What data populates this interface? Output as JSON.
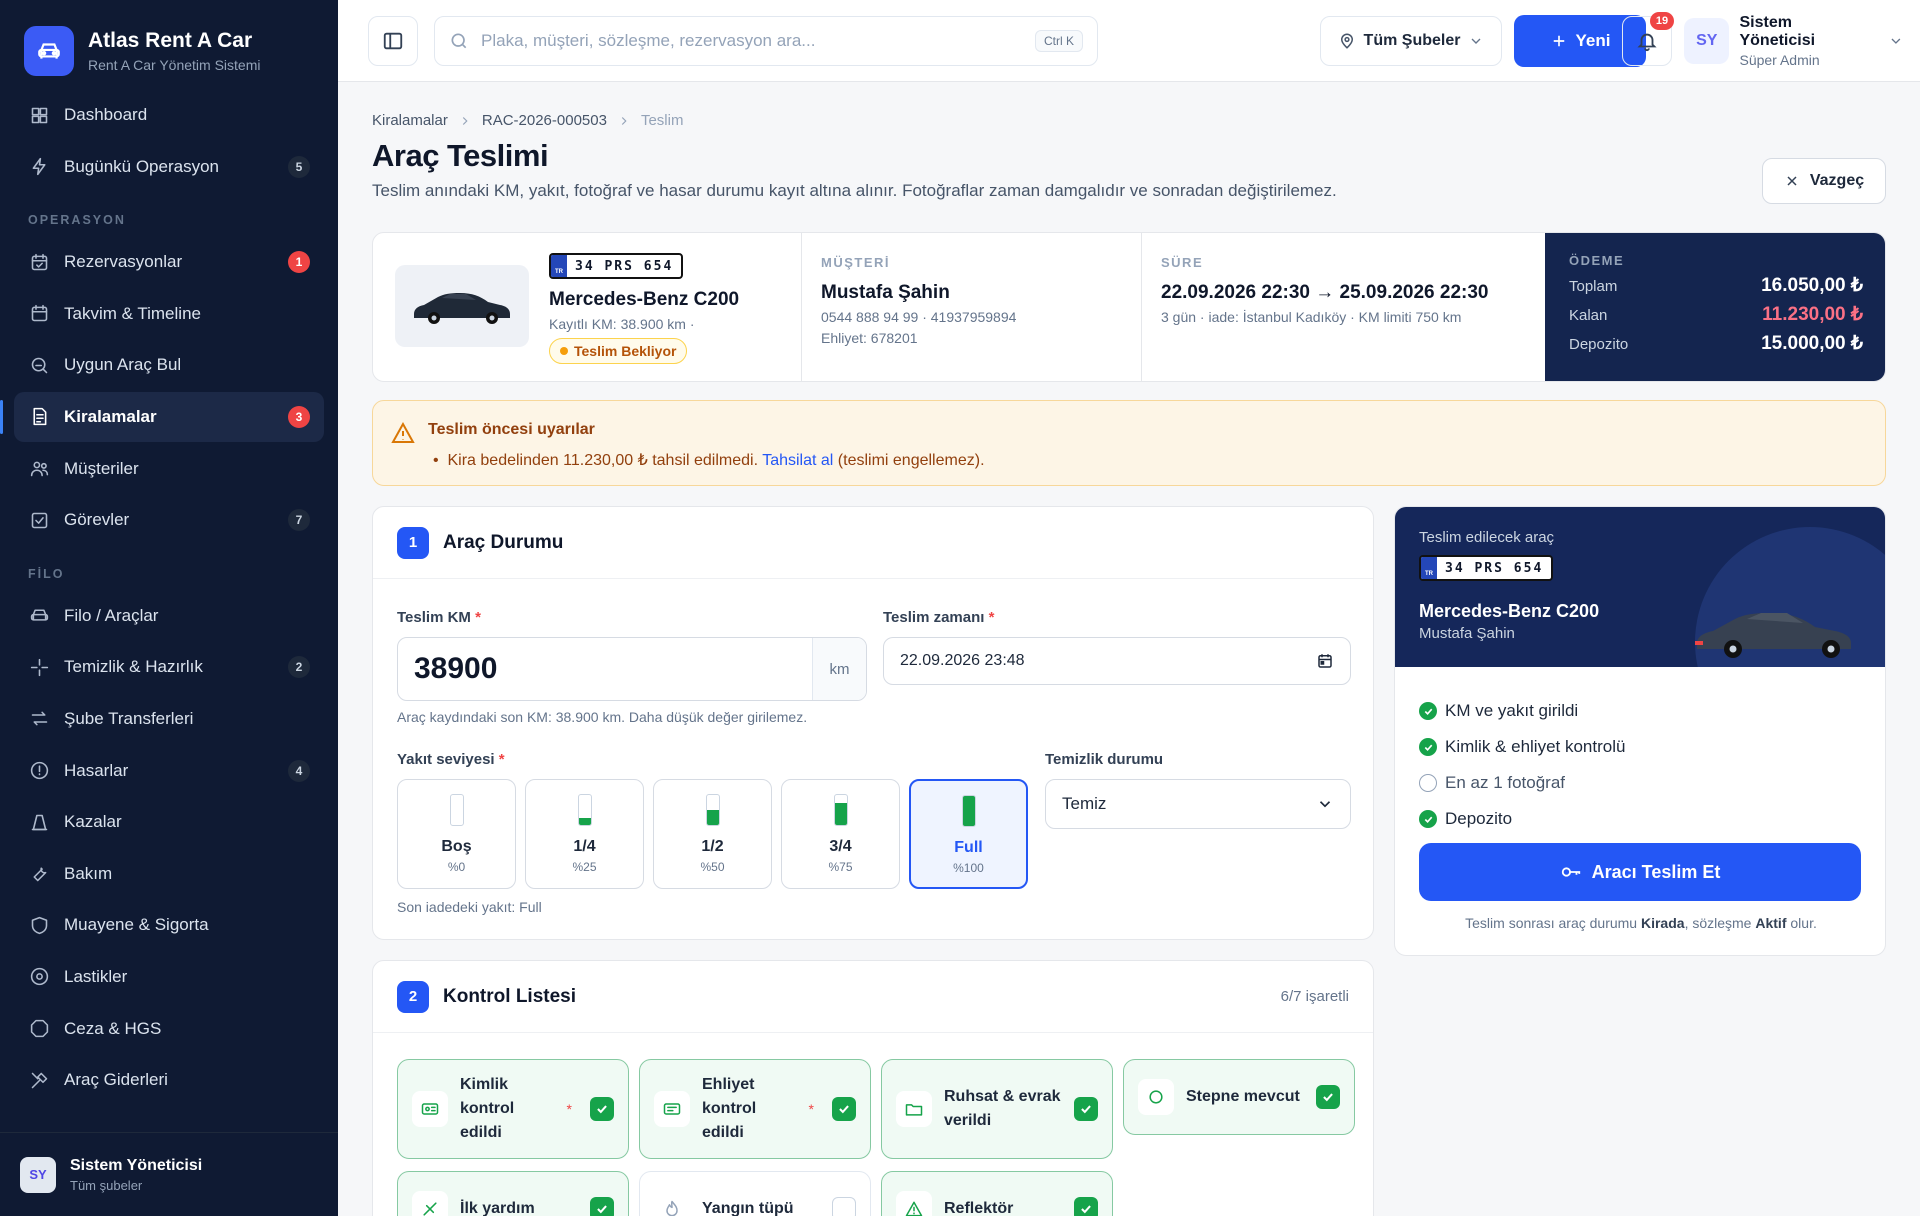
{
  "brand": {
    "title": "Atlas Rent A Car",
    "subtitle": "Rent A Car Yönetim Sistemi"
  },
  "sidebar": {
    "top_items": [
      {
        "label": "Dashboard",
        "icon": "dashboard-icon",
        "badge": ""
      },
      {
        "label": "Bugünkü Operasyon",
        "icon": "bolt-icon",
        "badge": "5"
      }
    ],
    "section_operasyon": "OPERASYON",
    "operasyon_items": [
      {
        "label": "Rezervasyonlar",
        "icon": "calendar-check-icon",
        "badge": "1",
        "badge_color": "#ef4444"
      },
      {
        "label": "Takvim & Timeline",
        "icon": "calendar-icon",
        "badge": ""
      },
      {
        "label": "Uygun Araç Bul",
        "icon": "search-car-icon",
        "badge": ""
      },
      {
        "label": "Kiralamalar",
        "icon": "document-icon",
        "badge": "3",
        "badge_color": "#ef4444",
        "active": true
      },
      {
        "label": "Müşteriler",
        "icon": "users-icon",
        "badge": ""
      },
      {
        "label": "Görevler",
        "icon": "task-check-icon",
        "badge": "7"
      }
    ],
    "section_filo": "FİLO",
    "filo_items": [
      {
        "label": "Filo / Araçlar",
        "icon": "car-icon",
        "badge": ""
      },
      {
        "label": "Temizlik & Hazırlık",
        "icon": "sparkle-icon",
        "badge": "2"
      },
      {
        "label": "Şube Transferleri",
        "icon": "transfer-icon",
        "badge": ""
      },
      {
        "label": "Hasarlar",
        "icon": "alert-circle-icon",
        "badge": "4"
      },
      {
        "label": "Kazalar",
        "icon": "cone-icon",
        "badge": ""
      },
      {
        "label": "Bakım",
        "icon": "wrench-icon",
        "badge": ""
      },
      {
        "label": "Muayene & Sigorta",
        "icon": "shield-icon",
        "badge": ""
      },
      {
        "label": "Lastikler",
        "icon": "tire-icon",
        "badge": ""
      },
      {
        "label": "Ceza & HGS",
        "icon": "stop-sign-icon",
        "badge": ""
      },
      {
        "label": "Araç Giderleri",
        "icon": "tools-icon",
        "badge": ""
      }
    ],
    "user": {
      "initials": "SY",
      "name": "Sistem Yöneticisi",
      "role": "Tüm şubeler"
    }
  },
  "topbar": {
    "search_placeholder": "Plaka, müşteri, sözleşme, rezervasyon ara...",
    "search_shortcut": "Ctrl K",
    "branch": "Tüm Şubeler",
    "new_label": "Yeni",
    "notif_count": "19",
    "user": {
      "initials": "SY",
      "name": "Sistem Yöneticisi",
      "role": "Süper Admin"
    }
  },
  "breadcrumb": [
    "Kiralamalar",
    "RAC-2026-000503",
    "Teslim"
  ],
  "page": {
    "title": "Araç Teslimi",
    "subtitle": "Teslim anındaki KM, yakıt, fotoğraf ve hasar durumu kayıt altına alınır. Fotoğraflar zaman damgalıdır ve sonradan değiştirilemez.",
    "cancel_label": "Vazgeç"
  },
  "summary": {
    "plate_country": "TR",
    "plate": "34 PRS 654",
    "model": "Mercedes-Benz C200",
    "km_text": "Kayıtlı KM: 38.900 km ·",
    "status": "Teslim Bekliyor",
    "customer_label": "MÜŞTERİ",
    "customer_name": "Mustafa Şahin",
    "customer_contact": "0544 888 94 99 · 41937959894",
    "customer_license": "Ehliyet: 678201",
    "duration_label": "SÜRE",
    "duration_range": "22.09.2026 22:30 → 25.09.2026 22:30",
    "duration_detail": "3 gün · iade: İstanbul Kadıköy · KM limiti 750 km",
    "payment_label": "ÖDEME",
    "payment_rows": [
      {
        "label": "Toplam",
        "value": "16.050,00 ₺"
      },
      {
        "label": "Kalan",
        "value": "11.230,00 ₺"
      },
      {
        "label": "Depozito",
        "value": "15.000,00 ₺"
      }
    ]
  },
  "alert": {
    "title": "Teslim öncesi uyarılar",
    "text_before": "Kira bedelinden 11.230,00 ₺ tahsil edilmedi.",
    "link": "Tahsilat al",
    "text_after": "(teslimi engellemez)."
  },
  "vehicle_status": {
    "step": "1",
    "title": "Araç Durumu",
    "km_label": "Teslim KM",
    "km_value": "38900",
    "km_unit": "km",
    "km_hint": "Araç kaydındaki son KM: 38.900 km. Daha düşük değer girilemez.",
    "time_label": "Teslim zamanı",
    "time_value": "22.09.2026 23:48",
    "fuel_label": "Yakıt seviyesi",
    "fuel_options": [
      {
        "label": "Boş",
        "percent": "%0",
        "fill": 0
      },
      {
        "label": "1/4",
        "percent": "%25",
        "fill": 0.25
      },
      {
        "label": "1/2",
        "percent": "%50",
        "fill": 0.5
      },
      {
        "label": "3/4",
        "percent": "%75",
        "fill": 0.75
      },
      {
        "label": "Full",
        "percent": "%100",
        "fill": 1,
        "selected": true
      }
    ],
    "fuel_hint": "Son iadedeki yakıt: Full",
    "clean_label": "Temizlik durumu",
    "clean_value": "Temiz",
    "required_mark": "*"
  },
  "checklist": {
    "step": "2",
    "title": "Kontrol Listesi",
    "count": "6/7 işaretli",
    "required_mark": "*",
    "items": [
      {
        "label": "Kimlik kontrol edildi",
        "icon": "id-card-icon",
        "required": true,
        "checked": true
      },
      {
        "label": "Ehliyet kontrol edildi",
        "icon": "license-icon",
        "required": true,
        "checked": true
      },
      {
        "label": "Ruhsat & evrak verildi",
        "icon": "folder-icon",
        "required": false,
        "checked": true
      },
      {
        "label": "Stepne mevcut",
        "icon": "circle-icon",
        "required": false,
        "checked": true
      },
      {
        "label": "İlk yardım",
        "icon": "first-aid-icon",
        "required": false,
        "checked": true
      },
      {
        "label": "Yangın tüpü",
        "icon": "fire-icon",
        "required": false,
        "checked": false
      },
      {
        "label": "Reflektör",
        "icon": "warning-triangle-icon",
        "required": false,
        "checked": true
      }
    ]
  },
  "handover": {
    "subtitle": "Teslim edilecek araç",
    "plate_country": "TR",
    "plate": "34 PRS 654",
    "model": "Mercedes-Benz C200",
    "customer": "Mustafa Şahin",
    "checks": [
      {
        "label": "KM ve yakıt girildi",
        "done": true
      },
      {
        "label": "Kimlik & ehliyet kontrolü",
        "done": true
      },
      {
        "label": "En az 1 fotoğraf",
        "done": false
      },
      {
        "label": "Depozito",
        "done": true
      }
    ],
    "cta": "Aracı Teslim Et",
    "note_1": "Teslim sonrası araç durumu",
    "note_status": "Kirada",
    "note_2": ", sözleşme",
    "note_contract": "Aktif",
    "note_3": "olur."
  },
  "colors": {
    "accent": "#2457f5",
    "sidebar_bg": "#0f1a33",
    "success": "#16a34a",
    "danger": "#ef4444",
    "warning_bg": "#fdf5e6"
  }
}
